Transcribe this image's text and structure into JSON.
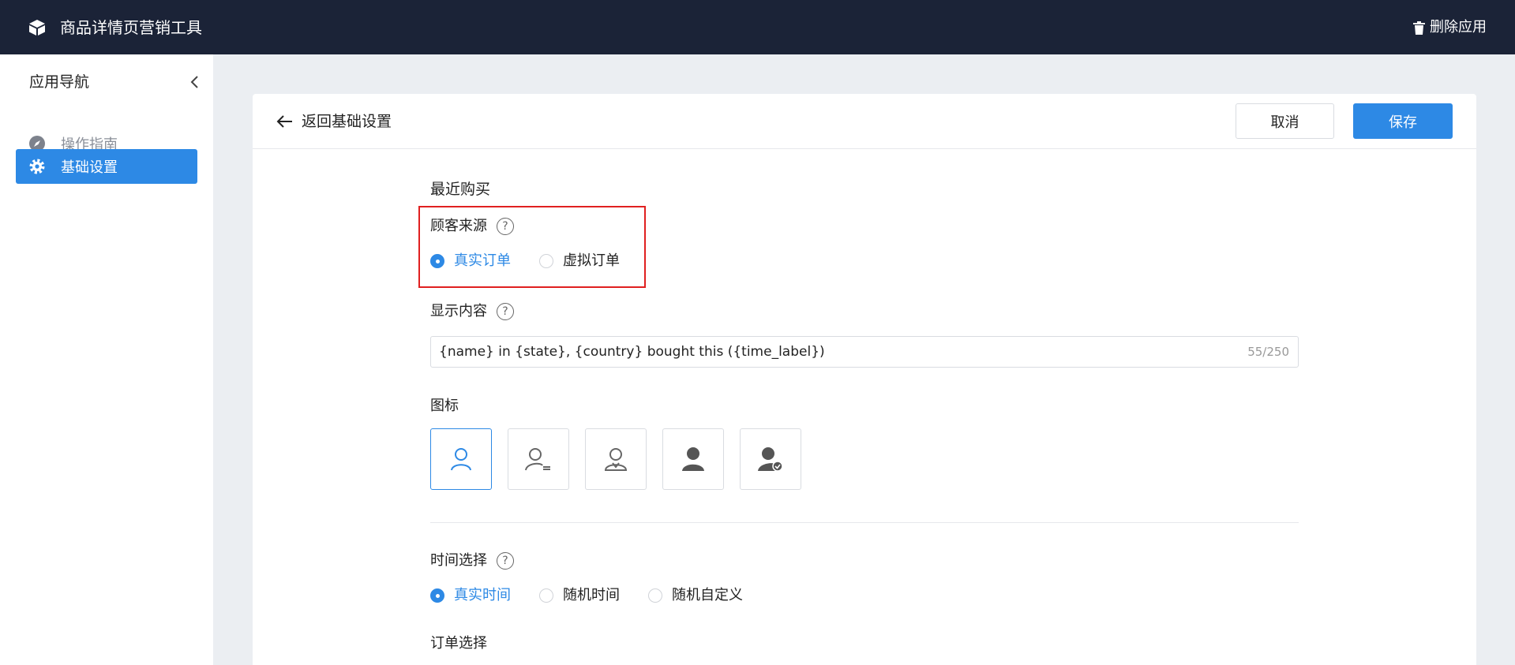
{
  "topbar": {
    "title": "商品详情页营销工具",
    "delete_label": "删除应用"
  },
  "sidebar": {
    "title": "应用导航",
    "items": [
      {
        "label": "操作指南",
        "icon": "compass-icon",
        "active": false
      },
      {
        "label": "基础设置",
        "icon": "gear-icon",
        "active": true
      }
    ]
  },
  "header": {
    "back_label": "返回基础设置",
    "cancel_label": "取消",
    "save_label": "保存"
  },
  "form": {
    "section_title": "最近购买",
    "customer_source": {
      "label": "顾客来源",
      "help": "?",
      "options": [
        "真实订单",
        "虚拟订单"
      ],
      "selected": "真实订单"
    },
    "display_content": {
      "label": "显示内容",
      "help": "?",
      "value": "{name} in {state}, {country} bought this ({time_label})",
      "counter": "55/250"
    },
    "icon_label": "图标",
    "icon_options": [
      "user-outline-icon",
      "user-list-icon",
      "user-tie-icon",
      "user-solid-icon",
      "user-check-icon"
    ],
    "time_select": {
      "label": "时间选择",
      "help": "?",
      "options": [
        "真实时间",
        "随机时间",
        "随机自定义"
      ],
      "selected": "真实时间"
    },
    "order_select_label": "订单选择"
  },
  "colors": {
    "accent": "#2d89e5",
    "topbar": "#1b2337",
    "highlight": "#e02020"
  }
}
